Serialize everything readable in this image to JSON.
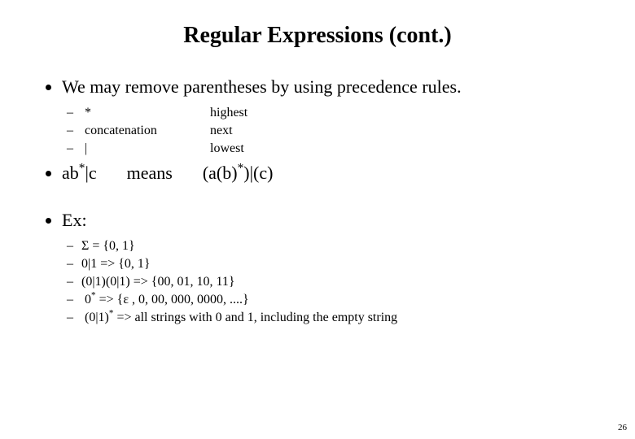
{
  "title": "Regular Expressions (cont.)",
  "bullet1": "We may remove parentheses by using precedence rules.",
  "prec": {
    "row1": {
      "op": "*",
      "rank": "highest"
    },
    "row2": {
      "op": "concatenation",
      "rank": "next"
    },
    "row3": {
      "op": "|",
      "rank": "lowest"
    }
  },
  "expr": {
    "lhs_pre": "ab",
    "lhs_post": "|c",
    "means": "means",
    "rhs_pre": "(a(b)",
    "rhs_post": ")|(c)"
  },
  "ex_label": "Ex:",
  "ex": {
    "l1": "Σ = {0, 1}",
    "l2": "0|1 => {0, 1}",
    "l3": "(0|1)(0|1)  =>  {00, 01, 10, 11}",
    "l4_pre": "0",
    "l4_post": "  =>  {ε , 0, 00, 000, 0000, ....}",
    "l5_pre": "(0|1)",
    "l5_post": "  =>  all strings with 0 and 1, including the empty string"
  },
  "star": "*",
  "page_number": "26"
}
